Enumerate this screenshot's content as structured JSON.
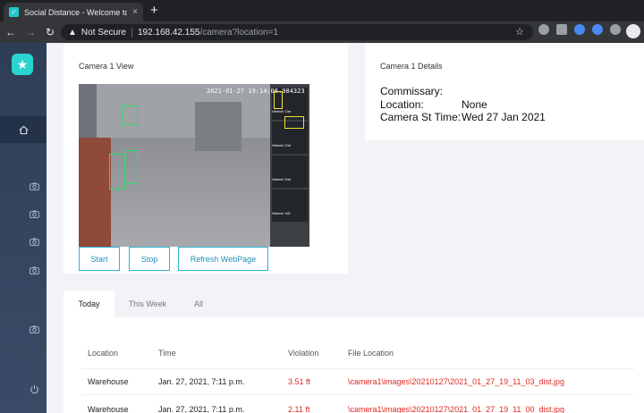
{
  "browser": {
    "tab_title": "Social Distance - Welcome to",
    "tab_close": "×",
    "new_tab": "+",
    "not_secure": "Not Secure",
    "url_host": "192.168.42.155",
    "url_path": "/camera?location=1"
  },
  "view": {
    "title": "Camera 1 View",
    "timestamp": "2021-01-27  19:14:06.984323",
    "panel_labels": [
      "Helmet: Det",
      "Helmet: Det",
      "Helmet: Det",
      "Helmet: ND"
    ],
    "buttons": {
      "start": "Start",
      "stop": "Stop",
      "refresh": "Refresh WebPage"
    }
  },
  "details": {
    "title": "Camera 1 Details",
    "rows": [
      {
        "label": "Commissary:",
        "value": ""
      },
      {
        "label": "Location:",
        "value": "None"
      },
      {
        "label": "Camera St Time:",
        "value": "Wed 27 Jan 2021"
      }
    ]
  },
  "tabs": [
    "Today",
    "This Week",
    "All"
  ],
  "table": {
    "headers": [
      "Location",
      "Time",
      "Violation",
      "File Location"
    ],
    "rows": [
      [
        "Warehouse",
        "Jan. 27, 2021, 7:11 p.m.",
        "3.51 ft",
        "\\camera1\\images\\20210127\\2021_01_27_19_11_03_dist.jpg"
      ],
      [
        "Warehouse",
        "Jan. 27, 2021, 7:11 p.m.",
        "2.11 ft",
        "\\camera1\\images\\20210127\\2021_01_27_19_11_00_dist.jpg"
      ]
    ]
  },
  "colors": {
    "sidebar": "#2e3e57",
    "accent": "#2ab5d6",
    "logo": "#2ad4d0",
    "violation": "#e0281f"
  }
}
